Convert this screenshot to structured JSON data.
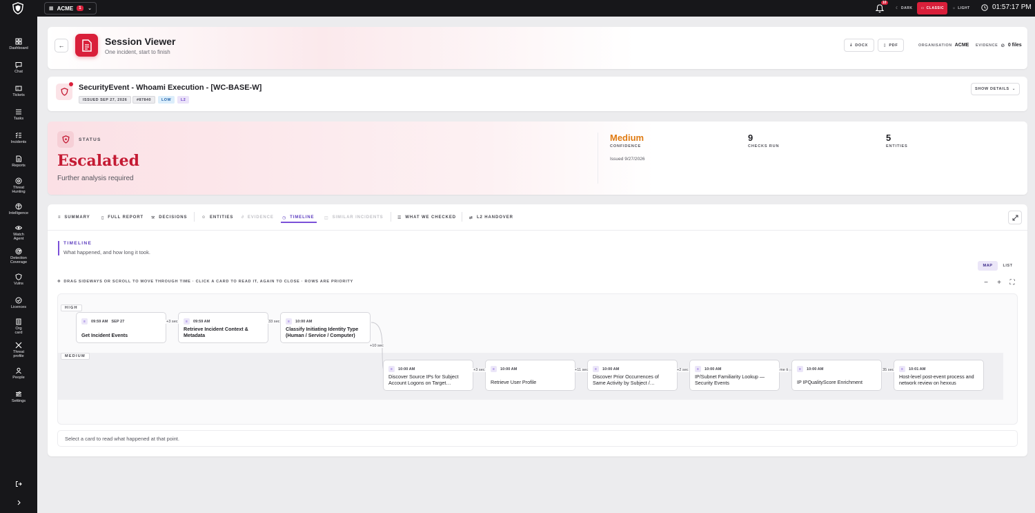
{
  "topbar": {
    "org_name": "ACME",
    "org_count": "1",
    "notifications": "10",
    "themes": [
      {
        "label": "DARK",
        "active": false
      },
      {
        "label": "CLASSIC",
        "active": true
      },
      {
        "label": "LIGHT",
        "active": false
      }
    ],
    "time": "01:57:17 PM"
  },
  "sidebar": {
    "items": [
      {
        "label": "Dashboard",
        "icon": "grid-icon"
      },
      {
        "label": "Chat",
        "icon": "chat-icon"
      },
      {
        "label": "Tickets",
        "icon": "ticket-icon"
      },
      {
        "label": "Tasks",
        "icon": "tasks-icon"
      },
      {
        "label": "Incidents",
        "icon": "incident-icon"
      },
      {
        "label": "Reports",
        "icon": "report-icon"
      },
      {
        "label": "Threat\nHunting",
        "icon": "target-icon"
      },
      {
        "label": "Intelligence",
        "icon": "brain-icon"
      },
      {
        "label": "Watch\nAgent",
        "icon": "eye-icon"
      },
      {
        "label": "Detection\nCoverage",
        "icon": "radar-icon"
      },
      {
        "label": "Vulns",
        "icon": "shield-icon"
      },
      {
        "label": "Licences",
        "icon": "check-circle-icon"
      },
      {
        "label": "Org\ncard",
        "icon": "org-card-icon"
      },
      {
        "label": "Threat\nprofile",
        "icon": "crossed-icon"
      },
      {
        "label": "People",
        "icon": "people-icon"
      },
      {
        "label": "Settings",
        "icon": "sliders-icon"
      }
    ]
  },
  "hero": {
    "title": "Session Viewer",
    "subtitle": "One incident, start to finish",
    "docx_label": "DOCX",
    "pdf_label": "PDF",
    "org_label": "ORGANISATION",
    "org_value": "ACME",
    "evidence_label": "EVIDENCE",
    "evidence_value": "0 files"
  },
  "incident": {
    "title": "SecurityEvent - Whoami Execution - [WC-BASE-W]",
    "tags": [
      "ISSUED SEP 27, 2026",
      "#87840",
      "LOW",
      "L2"
    ],
    "show_details": "SHOW DETAILS"
  },
  "status": {
    "label": "STATUS",
    "value": "Escalated",
    "subtitle": "Further analysis required",
    "confidence_value": "Medium",
    "confidence_label": "CONFIDENCE",
    "issued": "Issued 9/27/2026",
    "checks_value": "9",
    "checks_label": "CHECKS RUN",
    "entities_value": "5",
    "entities_label": "ENTITIES",
    "colors": {
      "escalated": "#c41a33",
      "confidence": "#e07b12"
    }
  },
  "tabs": [
    {
      "label": "SUMMARY",
      "state": "normal"
    },
    {
      "label": "FULL REPORT",
      "state": "normal"
    },
    {
      "label": "DECISIONS",
      "state": "normal"
    },
    {
      "label": "ENTITIES",
      "state": "normal"
    },
    {
      "label": "EVIDENCE",
      "state": "disabled"
    },
    {
      "label": "TIMELINE",
      "state": "active"
    },
    {
      "label": "SIMILAR INCIDENTS",
      "state": "disabled"
    },
    {
      "label": "WHAT WE CHECKED",
      "state": "normal"
    },
    {
      "label": "L2 HANDOVER",
      "state": "normal"
    }
  ],
  "timeline": {
    "title": "TIMELINE",
    "subtitle": "What happened, and how long it took.",
    "view_map": "MAP",
    "view_list": "LIST",
    "hint": "DRAG SIDEWAYS OR SCROLL TO MOVE THROUGH TIME · CLICK A CARD TO READ IT, AGAIN TO CLOSE · ROWS ARE PRIORITY",
    "lanes": {
      "high": "HIGH",
      "medium": "MEDIUM"
    },
    "events": [
      {
        "time": "09:59 AM",
        "date": "SEP 27",
        "title": "Get Incident Events",
        "lane": "high"
      },
      {
        "time": "09:59 AM",
        "date": "",
        "title": "Retrieve Incident Context & Metadata",
        "lane": "high"
      },
      {
        "time": "10:00 AM",
        "date": "",
        "title": "Classify Initiating Identity Type (Human / Service / Computer)",
        "lane": "high"
      },
      {
        "time": "10:00 AM",
        "date": "",
        "title": "Discover Source IPs for Subject Account Logons on Target…",
        "lane": "medium"
      },
      {
        "time": "10:00 AM",
        "date": "",
        "title": "Retrieve User Profile",
        "lane": "medium"
      },
      {
        "time": "10:00 AM",
        "date": "",
        "title": "Discover Prior Occurrences of Same Activity by Subject /…",
        "lane": "medium"
      },
      {
        "time": "10:00 AM",
        "date": "",
        "title": "IP/Subnet Familiarity Lookup — Security Events",
        "lane": "medium"
      },
      {
        "time": "10:00 AM",
        "date": "",
        "title": "IP IPQualityScore Enrichment",
        "lane": "medium"
      },
      {
        "time": "10:01 AM",
        "date": "",
        "title": "Host-level post-event process and network review on hexxus",
        "lane": "medium"
      }
    ],
    "gaps": [
      "+3 sec",
      "33 sec",
      "+10 sec",
      "+3 sec",
      "+11 sec",
      "+2 sec",
      "me ti",
      "35 sec"
    ],
    "footer": "Select a card to read what happened at that point."
  }
}
